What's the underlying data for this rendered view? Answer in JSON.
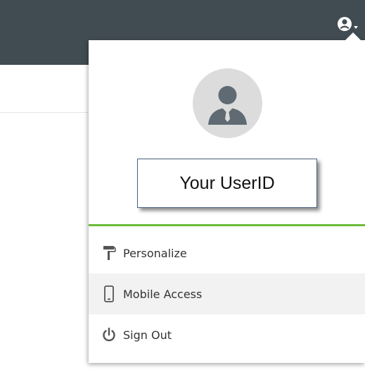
{
  "header": {
    "user_menu_icon": "user-circle-icon",
    "user_menu_chevron": "chevron-down-icon"
  },
  "profile": {
    "avatar_icon": "businessman-avatar-icon",
    "user_id": "Your UserID"
  },
  "menu": {
    "items": [
      {
        "label": "Personalize",
        "icon": "paint-roller-icon",
        "highlighted": false
      },
      {
        "label": "Mobile Access",
        "icon": "mobile-phone-icon",
        "highlighted": true
      },
      {
        "label": "Sign Out",
        "icon": "power-icon",
        "highlighted": false
      }
    ]
  },
  "colors": {
    "topbar": "#414b52",
    "accent_rule": "#6cbb3c",
    "avatar_bg": "#dcdcdc",
    "avatar_figure": "#5f6a72",
    "menu_hover": "#f2f2f2"
  }
}
